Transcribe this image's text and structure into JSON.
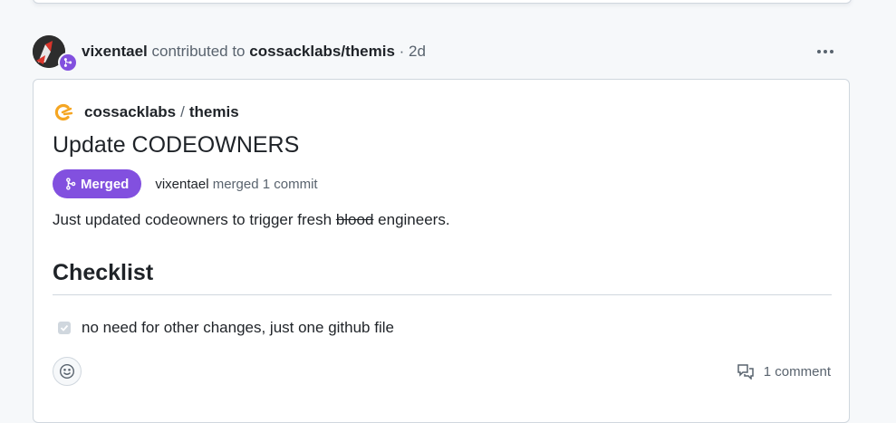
{
  "event": {
    "user": "vixentael",
    "action_text": "contributed to",
    "repo": "cossacklabs/themis",
    "separator": "·",
    "age": "2d",
    "more_label": "..."
  },
  "card": {
    "repo_owner": "cossacklabs",
    "repo_slash": "/",
    "repo_name": "themis",
    "pr_title": "Update CODEOWNERS",
    "status_label": "Merged",
    "merge_user": "vixentael",
    "merge_text": "merged 1 commit",
    "body_before": "Just updated codeowners to trigger fresh",
    "body_struck": "blood",
    "body_after": "engineers.",
    "checklist_title": "Checklist",
    "checklist_items": [
      {
        "label": "no need for other changes, just one github file",
        "checked": true
      }
    ],
    "comment_count_label": "1 comment"
  },
  "colors": {
    "merged_purple": "#8250df",
    "logo_orange": "#f5a623",
    "text_primary": "#1f2328",
    "text_muted": "#59636e"
  },
  "icons": [
    "git-merge-icon",
    "kebab-horizontal-icon",
    "smiley-icon",
    "comment-discussion-icon",
    "check-icon"
  ]
}
